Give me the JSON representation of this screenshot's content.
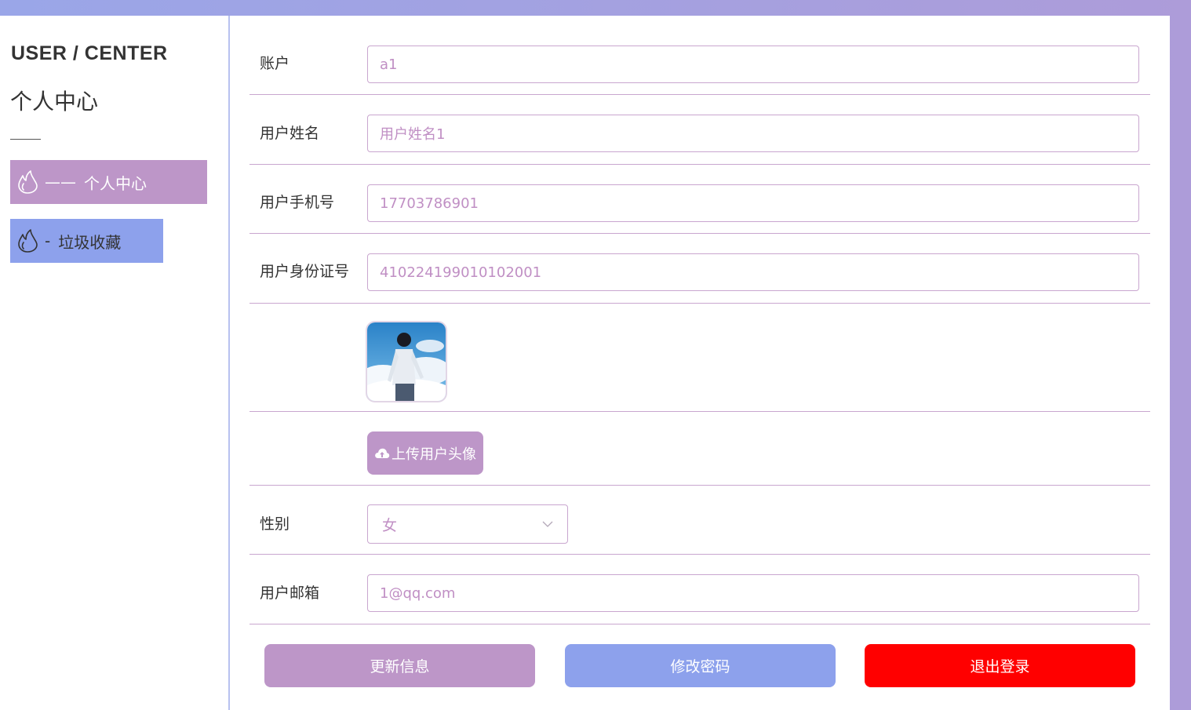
{
  "sidebar": {
    "title_en": "USER / CENTER",
    "title_cn": "个人中心",
    "items": [
      {
        "dash": "——",
        "label": "个人中心",
        "active": true
      },
      {
        "dash": "-",
        "label": "垃圾收藏",
        "active": false
      }
    ]
  },
  "form": {
    "account": {
      "label": "账户",
      "value": "a1"
    },
    "name": {
      "label": "用户姓名",
      "value": "用户姓名1"
    },
    "phone": {
      "label": "用户手机号",
      "value": "17703786901"
    },
    "id_card": {
      "label": "用户身份证号",
      "value": "410224199010102001"
    },
    "upload_label": "上传用户头像",
    "gender": {
      "label": "性别",
      "value": "女"
    },
    "email": {
      "label": "用户邮箱",
      "value": "1@qq.com"
    }
  },
  "actions": {
    "update": "更新信息",
    "change_password": "修改密码",
    "logout": "退出登录"
  },
  "colors": {
    "accent_purple": "#bd96c8",
    "accent_blue": "#8da1ec",
    "danger": "#ff0000",
    "field_text": "#c08fc4"
  },
  "icons": {
    "menu": "flame-icon",
    "upload": "cloud-upload-icon",
    "select": "chevron-down-icon"
  }
}
